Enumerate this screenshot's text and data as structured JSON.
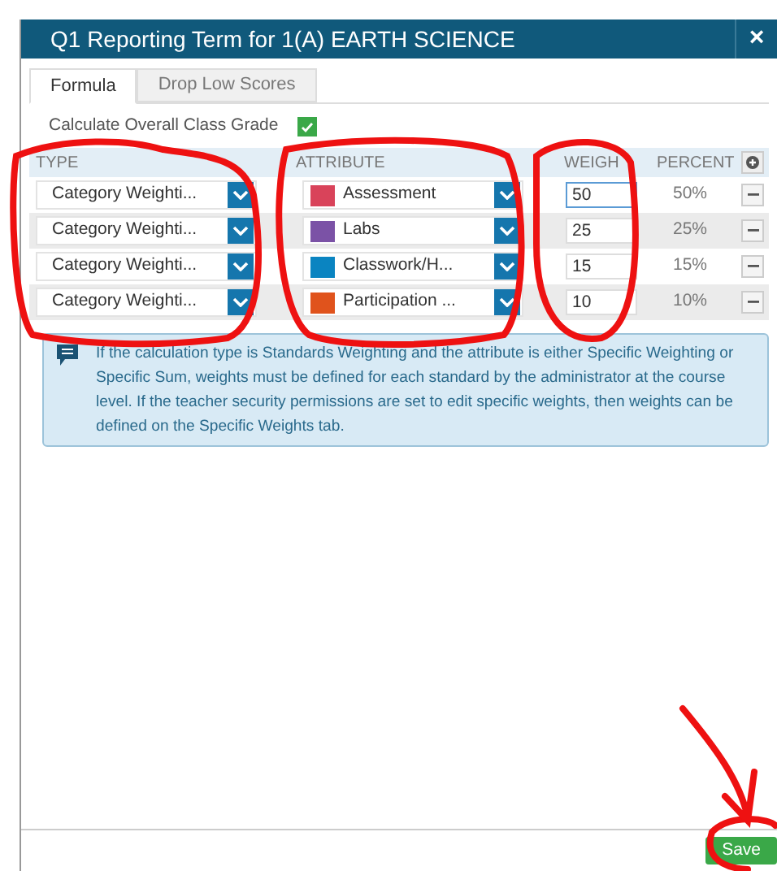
{
  "window": {
    "title": "Q1 Reporting Term for 1(A) EARTH SCIENCE",
    "close": "×"
  },
  "tabs": [
    {
      "label": "Formula",
      "selected": true
    },
    {
      "label": "Drop Low Scores",
      "selected": false
    }
  ],
  "calculate_overall": {
    "label": "Calculate Overall Class Grade",
    "checked": true
  },
  "table": {
    "columns": [
      "TYPE",
      "ATTRIBUTE",
      "WEIGH",
      "PERCENT"
    ],
    "rows": [
      {
        "type": "Category Weighti...",
        "attribute": "Assessment",
        "color": "#d9435a",
        "weight": "50",
        "percent": "50%",
        "focused": true
      },
      {
        "type": "Category Weighti...",
        "attribute": "Labs",
        "color": "#7b52a6",
        "weight": "25",
        "percent": "25%",
        "focused": false
      },
      {
        "type": "Category Weighti...",
        "attribute": "Classwork/H...",
        "color": "#0a84c1",
        "weight": "15",
        "percent": "15%",
        "focused": false
      },
      {
        "type": "Category Weighti...",
        "attribute": "Participation ...",
        "color": "#e0531c",
        "weight": "10",
        "percent": "10%",
        "focused": false
      }
    ]
  },
  "info": "If the calculation type is Standards Weighting and the attribute is either Specific Weighting or Specific Sum, weights must be defined for each standard by the administrator at the course level. If the teacher security permissions are set to edit specific weights, then weights can be defined on the Specific Weights tab.",
  "buttons": [
    "Save"
  ]
}
